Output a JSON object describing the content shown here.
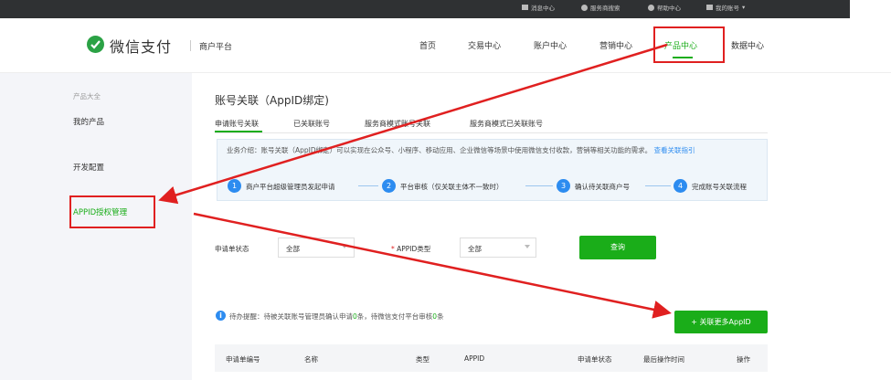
{
  "topbar": {
    "links": [
      "消息中心",
      "服务商搜索",
      "帮助中心",
      "我的账号"
    ]
  },
  "header": {
    "logo_text": "微信支付",
    "platform": "商户平台",
    "nav": [
      "首页",
      "交易中心",
      "账户中心",
      "营销中心",
      "产品中心",
      "数据中心"
    ],
    "active_nav": "产品中心"
  },
  "sidebar": {
    "group_title": "产品大全",
    "items": [
      "我的产品",
      "开发配置",
      "APPID授权管理"
    ],
    "active_item": "APPID授权管理"
  },
  "main": {
    "title": "账号关联（AppID绑定)",
    "tabs": [
      "申请账号关联",
      "已关联账号",
      "服务商模式账号关联",
      "服务商模式已关联账号"
    ],
    "info": {
      "text": "业务介绍：账号关联（AppID绑定）可以实现在公众号、小程序、移动应用、企业微信等场景中使用微信支付收款，营销等相关功能的需求。",
      "link": "查看关联指引"
    },
    "steps": [
      {
        "num": "1",
        "label": "商户平台超级管理员发起申请"
      },
      {
        "num": "2",
        "label": "平台审核（仅关联主体不一致时）"
      },
      {
        "num": "3",
        "label": "确认待关联商户号"
      },
      {
        "num": "4",
        "label": "完成账号关联流程"
      }
    ],
    "filters": {
      "status_label": "申请单状态",
      "status_value": "全部",
      "type_required": "*",
      "type_label": "APPID类型",
      "type_value": "全部",
      "query_button": "查询"
    },
    "notice": {
      "prefix": "待办提醒：待被关联账号管理员确认申请",
      "count1": "0",
      "middle": "条，待微信支付平台审核",
      "count2": "0",
      "suffix": "条"
    },
    "add_button": "+ 关联更多AppID",
    "table_headers": [
      "申请单编号",
      "名称",
      "类型",
      "APPID",
      "申请单状态",
      "最后操作时间",
      "操作"
    ]
  },
  "colors": {
    "accent": "#1aad19",
    "highlight_red": "#e02020",
    "info_blue": "#2d8cf0"
  }
}
